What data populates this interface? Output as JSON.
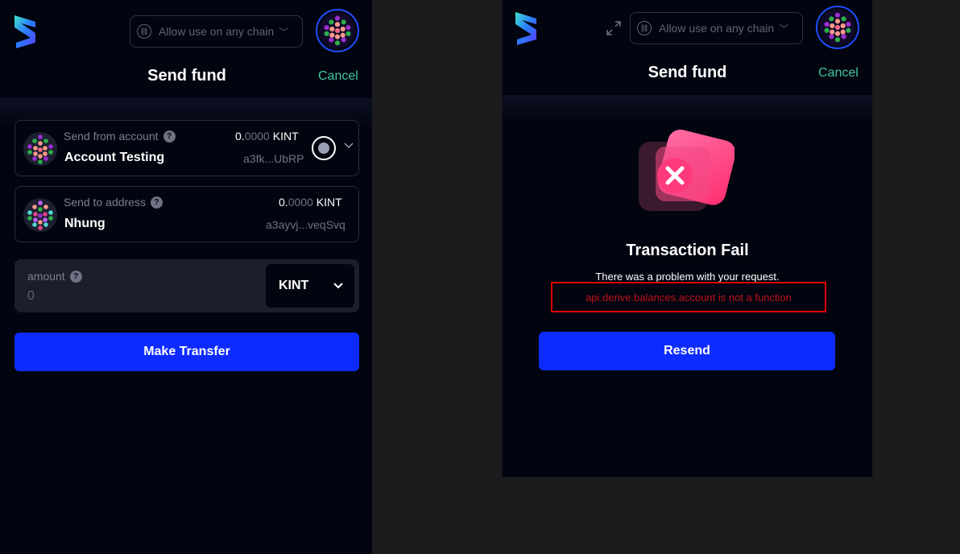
{
  "colors": {
    "accent": "#0d2bff",
    "cancel": "#42c59a",
    "error": "#c0111a",
    "highlight": "#e00000",
    "panel": "#020510"
  },
  "left_panel": {
    "header": {
      "logo_icon": "subwallet-logo-icon",
      "chain_select": {
        "label": "Allow use on any chain",
        "icon": "chain-icon",
        "chevron": "chevron-down-icon"
      },
      "avatar": "account-avatar",
      "title": "Send fund",
      "cancel_label": "Cancel"
    },
    "from_account": {
      "label": "Send from account",
      "name": "Account Testing",
      "balance_int": "0.",
      "balance_dec": "0000",
      "balance_token": " KINT",
      "address": "a3fk...UbRP"
    },
    "to_address": {
      "label": "Send to address",
      "name": "Nhung",
      "balance_int": "0.",
      "balance_dec": "0000",
      "balance_token": " KINT",
      "address": "a3ayvj...veqSvq"
    },
    "amount": {
      "label": "amount",
      "value": "0",
      "token": "KINT"
    },
    "submit_label": "Make Transfer"
  },
  "right_panel": {
    "header": {
      "logo_icon": "subwallet-logo-icon",
      "expand_icon": "expand-icon",
      "chain_select": {
        "label": "Allow use on any chain",
        "icon": "chain-icon",
        "chevron": "chevron-down-icon"
      },
      "avatar": "account-avatar",
      "title": "Send fund",
      "cancel_label": "Cancel"
    },
    "result": {
      "title": "Transaction Fail",
      "message": "There was a problem with your request.",
      "error": "api.derive.balances.account is not a function"
    },
    "resend_label": "Resend"
  }
}
